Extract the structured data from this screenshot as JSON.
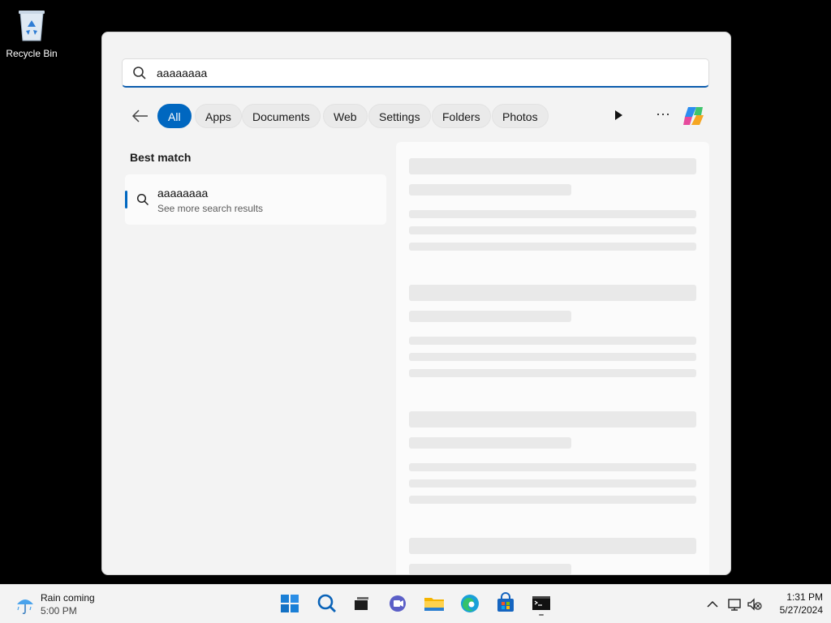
{
  "desktop": {
    "recycle_bin_label": "Recycle Bin"
  },
  "search": {
    "query": "aaaaaaaa"
  },
  "filters": {
    "chips": [
      "All",
      "Apps",
      "Documents",
      "Web",
      "Settings",
      "Folders",
      "Photos"
    ],
    "active": "All",
    "more_label": "···"
  },
  "best_match": {
    "heading": "Best match",
    "title": "aaaaaaaa",
    "subtitle": "See more search results"
  },
  "taskbar": {
    "weather_title": "Rain coming",
    "weather_time": "5:00 PM",
    "time": "1:31 PM",
    "date": "5/27/2024",
    "icons": [
      "start-icon",
      "search-icon",
      "task-view-icon",
      "teams-chat-icon",
      "file-explorer-icon",
      "edge-icon",
      "store-icon",
      "terminal-icon"
    ]
  },
  "colors": {
    "accent": "#0067c0",
    "panel_bg": "#f3f3f3",
    "desktop_bg": "#000000"
  }
}
